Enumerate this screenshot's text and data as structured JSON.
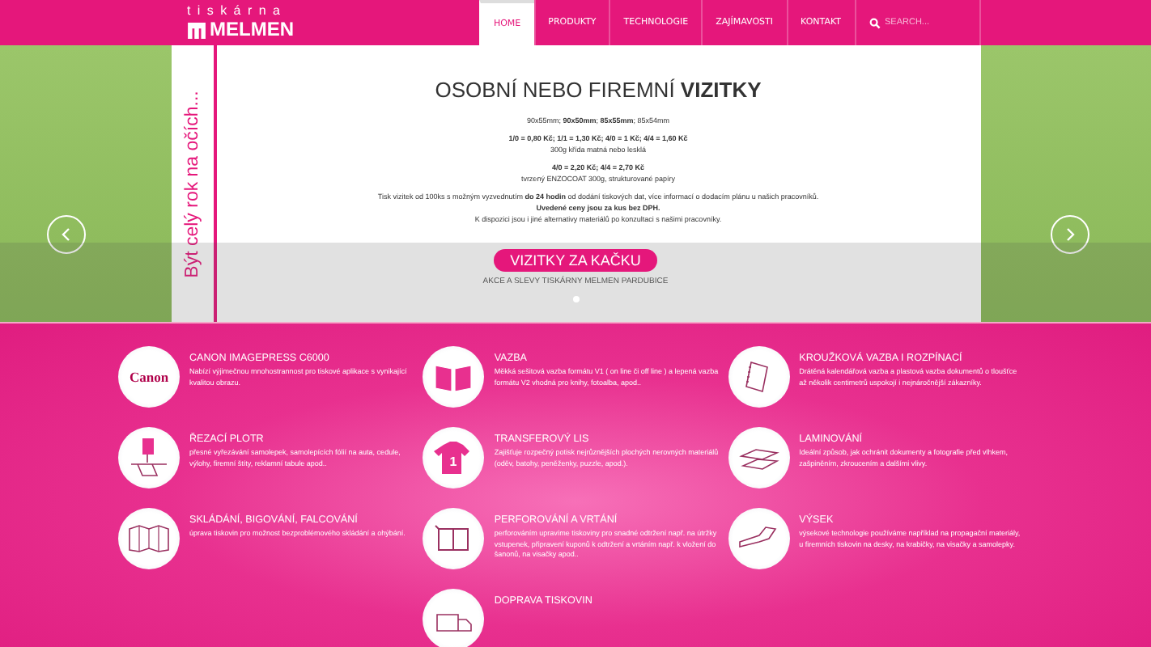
{
  "logo": {
    "top": "tiskárna",
    "name": "MELMEN"
  },
  "nav": [
    {
      "label": "HOME",
      "selected": true
    },
    {
      "label": "PRODUKTY",
      "selected": false
    },
    {
      "label": "TECHNOLOGIE",
      "selected": false
    },
    {
      "label": "ZAJÍMAVOSTI",
      "selected": false
    },
    {
      "label": "KONTAKT",
      "selected": false
    }
  ],
  "search": {
    "placeholder": "SEARCH..."
  },
  "hero": {
    "side_text": "Být celý rok na očích...",
    "title": "OSOBNÍ NEBO FIREMNÍ **VIZITKY**",
    "groups": [
      [
        {
          "text": "90x55mm; **90x50mm**; **85x55mm**; 85x54mm",
          "bold": false
        }
      ],
      [
        {
          "text": "1/0 = 0,80 Kč; 1/1 = 1,30 Kč; 4/0 = 1 Kč; 4/4 = 1,60 Kč",
          "bold": true
        },
        {
          "text": "300g křída matná nebo lesklá",
          "bold": false
        }
      ],
      [
        {
          "text": "4/0 = 2,20 Kč; 4/4 = 2,70 Kč",
          "bold": true
        },
        {
          "text": "tvrzený ENZOCOAT 300g, strukturované papíry",
          "bold": false
        }
      ],
      [
        {
          "text": "Tisk vizitek od 100ks s možným vyzvednutím **do 24 hodin** od dodání tiskových dat, více informací o dodacím plánu u našich pracovníků.",
          "bold": false
        },
        {
          "text": "Uvedené ceny jsou za kus bez DPH.",
          "bold": true
        },
        {
          "text": "K dispozici jsou i jiné alternativy materiálů po konzultaci s našimi pracovníky.",
          "bold": false
        }
      ]
    ],
    "button": "VIZITKY ZA KAČKU",
    "subtitle": "AKCE A SLEVY TISKÁRNY MELMEN PARDUBICE"
  },
  "services": [
    {
      "kind": "canon",
      "icon_text": "Canon",
      "title": "CANON IMAGEPRESS C6000",
      "text": "Nabízí výjimečnou mnohostrannost pro tiskové aplikace s vynikající kvalitou obrazu."
    },
    {
      "kind": "book",
      "title": "VAZBA",
      "text": "Měkká sešitová vazba formátu V1 ( on line či off line ) a lepená vazba formátu V2 vhodná pro knihy, fotoalba, apod.."
    },
    {
      "kind": "ring",
      "title": "KROUŽKOVÁ VAZBA I ROZPÍNACÍ",
      "text": "Drátěná kalendářová vazba a plastová vazba dokumentů o tloušťce až několik centimetrů uspokojí i nejnáročnější zákazníky."
    },
    {
      "kind": "plotter",
      "title": "ŘEZACÍ PLOTR",
      "text": "přesné vyřezávání samolepek, samolepících fólií na auta, cedule, výlohy, firemní štíty, reklamní tabule apod.."
    },
    {
      "kind": "shirt",
      "icon_text": "1",
      "title": "TRANSFEROVÝ LIS",
      "text": "Zajišťuje rozpečný potisk nejrůznějších plochých nerovných materiálů (oděv, batohy, peněženky, puzzle, apod.)."
    },
    {
      "kind": "laminate",
      "title": "LAMINOVÁNÍ",
      "text": "Ideální způsob, jak ochránit dokumenty a fotografie před vlhkem, zašpiněním, zkroucením a dalšími vlivy."
    },
    {
      "kind": "fold",
      "title": "SKLÁDÁNÍ, BIGOVÁNÍ, FALCOVÁNÍ",
      "text": "úprava tiskovin pro možnost bezproblémového skládání a ohýbání."
    },
    {
      "kind": "perforate",
      "title": "PERFOROVÁNÍ A VRTÁNÍ",
      "text": "perforováním upravíme tiskoviny pro snadné odtržení např. na útržky vstupenek, připravení kuponů k odtržení a vrtáním např. k vložení do šanonů, na visačky apod.."
    },
    {
      "kind": "cut",
      "title": "VÝSEK",
      "text": "výsekové technologie používáme například na propagační materiály, u firemních tiskovin na desky, na krabičky, na visačky a samolepky."
    },
    {
      "kind": "truck",
      "title": "DOPRAVA TISKOVIN"
    }
  ]
}
